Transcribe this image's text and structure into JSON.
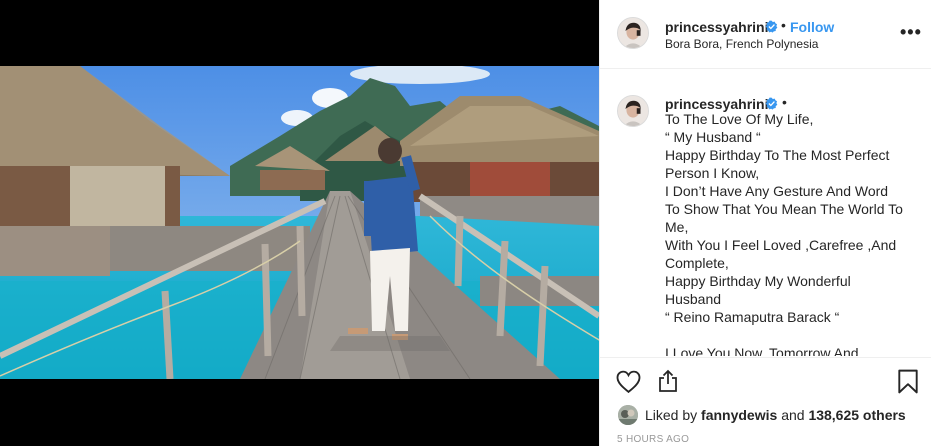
{
  "post": {
    "author": {
      "username": "princessyahrini",
      "verified": true,
      "follow_label": "Follow",
      "separator": "•",
      "location": "Bora Bora, French Polynesia"
    },
    "more_icon": "more-options-icon",
    "caption": {
      "separator": "•",
      "lines": [
        "To The Love Of My Life,",
        "“ My Husband “",
        "Happy Birthday To The Most Perfect",
        "Person I Know,",
        "I Don’t Have Any Gesture And Word",
        "To Show That You Mean The World To",
        "Me,",
        "With You I Feel Loved ,Carefree ,And",
        "Complete,",
        "Happy Birthday My Wonderful",
        "Husband",
        "“ Reino Ramaputra Barack “",
        "",
        "I Love You Now, Tomorrow And"
      ]
    },
    "actions": {
      "like_icon": "heart-icon",
      "share_icon": "share-icon",
      "save_icon": "bookmark-icon"
    },
    "likes": {
      "prefix": "Liked by",
      "liker": "fannydewis",
      "middle": "and",
      "others": "138,625 others"
    },
    "timestamp": "5 HOURS AGO"
  },
  "colors": {
    "link_blue": "#3897f0",
    "verified_blue": "#3897f0",
    "text": "#262626",
    "muted": "#999999",
    "divider": "#efefef"
  }
}
